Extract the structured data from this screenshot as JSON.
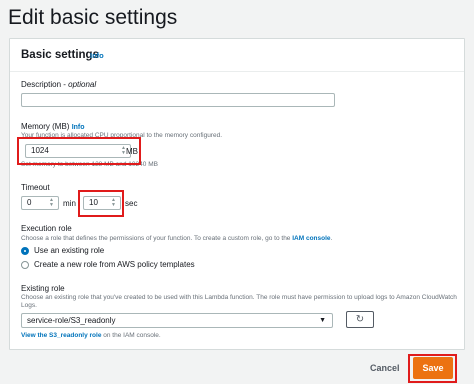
{
  "page": {
    "title": "Edit basic settings"
  },
  "panel": {
    "title": "Basic settings",
    "info": "Info"
  },
  "description": {
    "label": "Description",
    "optional": "optional",
    "value": ""
  },
  "memory": {
    "label": "Memory (MB)",
    "info": "Info",
    "hint": "Your function is allocated CPU proportional to the memory configured.",
    "value": "1024",
    "unit": "MB",
    "range_hint": "Set memory to between 128 MB and 10240 MB"
  },
  "timeout": {
    "label": "Timeout",
    "min_value": "0",
    "min_unit": "min",
    "sec_value": "10",
    "sec_unit": "sec"
  },
  "execution_role": {
    "label": "Execution role",
    "hint_prefix": "Choose a role that defines the permissions of your function. To create a custom role, go to the ",
    "hint_link": "IAM console",
    "options": [
      {
        "label": "Use an existing role",
        "selected": true
      },
      {
        "label": "Create a new role from AWS policy templates",
        "selected": false
      }
    ]
  },
  "existing_role": {
    "label": "Existing role",
    "hint": "Choose an existing role that you've created to be used with this Lambda function. The role must have permission to upload logs to Amazon CloudWatch Logs.",
    "selected": "service-role/S3_readonly",
    "view_link": "View the S3_readonly role",
    "view_suffix": " on the IAM console."
  },
  "footer": {
    "cancel": "Cancel",
    "save": "Save"
  },
  "colors": {
    "accent": "#0073bb",
    "save": "#ec7211",
    "highlight": "#e01b1b"
  }
}
